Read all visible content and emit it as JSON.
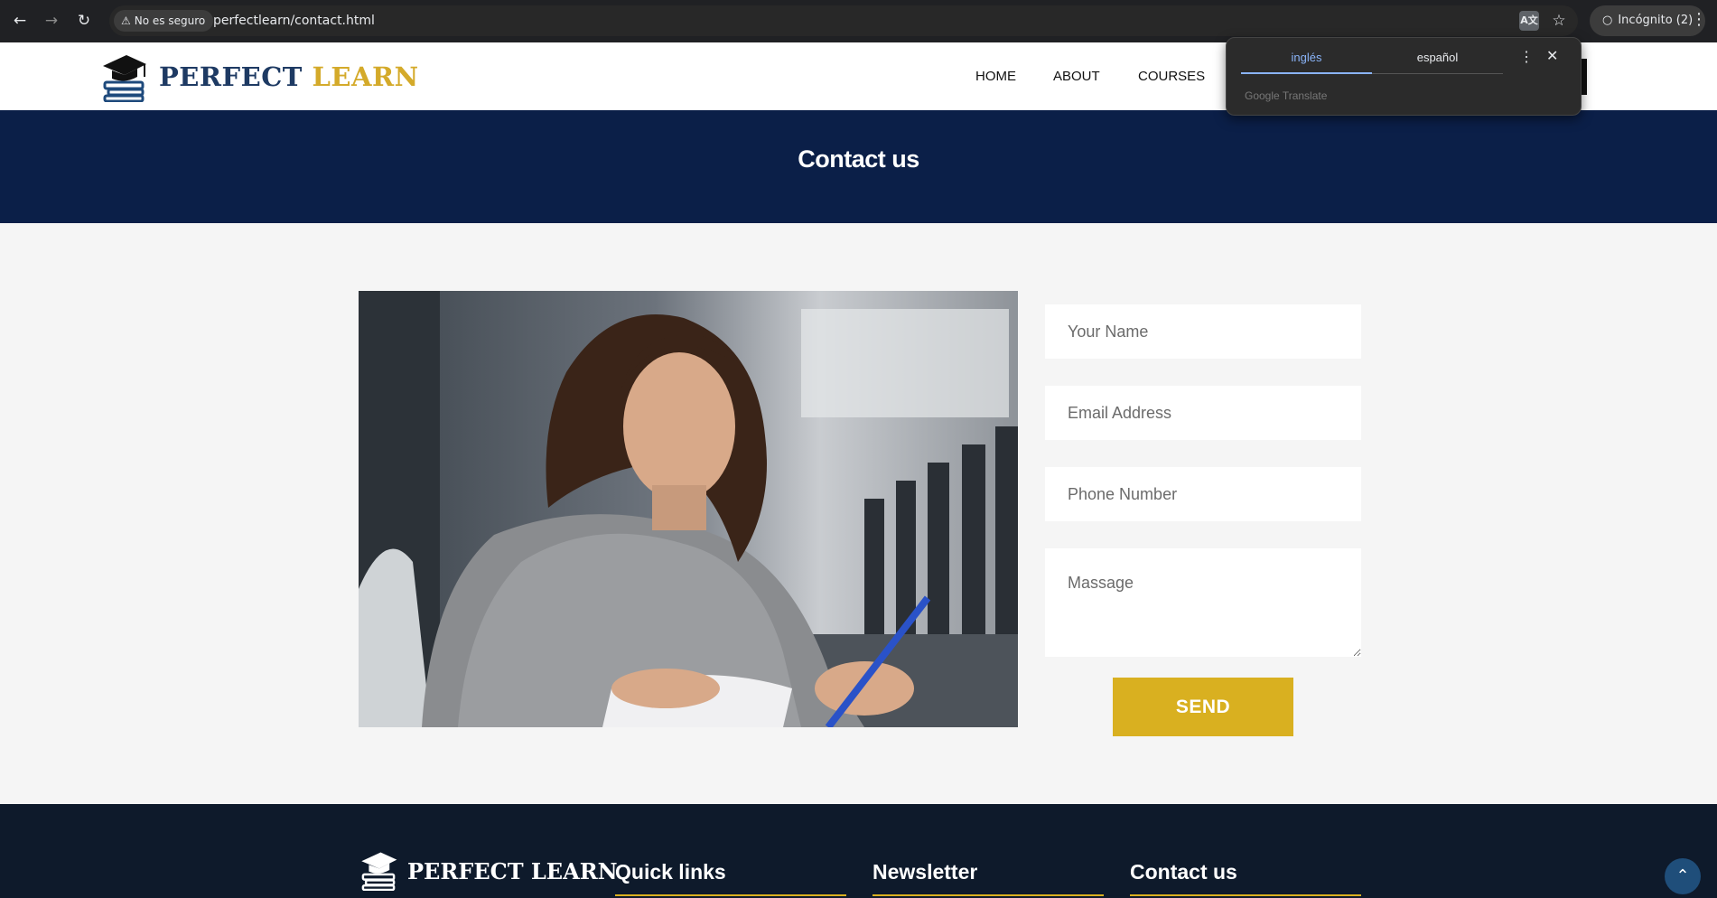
{
  "browser": {
    "security_label": "No es seguro",
    "url": "perfectlearn/contact.html",
    "incognito_label": "Incógnito (2)",
    "translate_icon_text": "A文"
  },
  "translate_popup": {
    "tab_source": "inglés",
    "tab_target": "español",
    "brand": "Google Translate"
  },
  "site": {
    "logo_word1": "PERFECT",
    "logo_word2": "LEARN",
    "nav": [
      "HOME",
      "ABOUT",
      "COURSES"
    ]
  },
  "hero": {
    "title": "Contact us"
  },
  "form": {
    "name_placeholder": "Your Name",
    "email_placeholder": "Email Address",
    "phone_placeholder": "Phone Number",
    "message_placeholder": "Massage",
    "send_label": "SEND"
  },
  "footer": {
    "logo_text": "PERFECT LEARN",
    "headings": [
      "Quick links",
      "Newsletter",
      "Contact us"
    ]
  },
  "colors": {
    "navy": "#0b1f48",
    "gold": "#d9b020",
    "footer_bg": "#0e1a2b"
  },
  "icons": [
    "back-arrow-icon",
    "forward-arrow-icon",
    "reload-icon",
    "warning-icon",
    "translate-icon",
    "star-icon",
    "incognito-icon",
    "more-options-icon",
    "close-icon",
    "graduation-cap-icon",
    "chevron-up-icon"
  ]
}
